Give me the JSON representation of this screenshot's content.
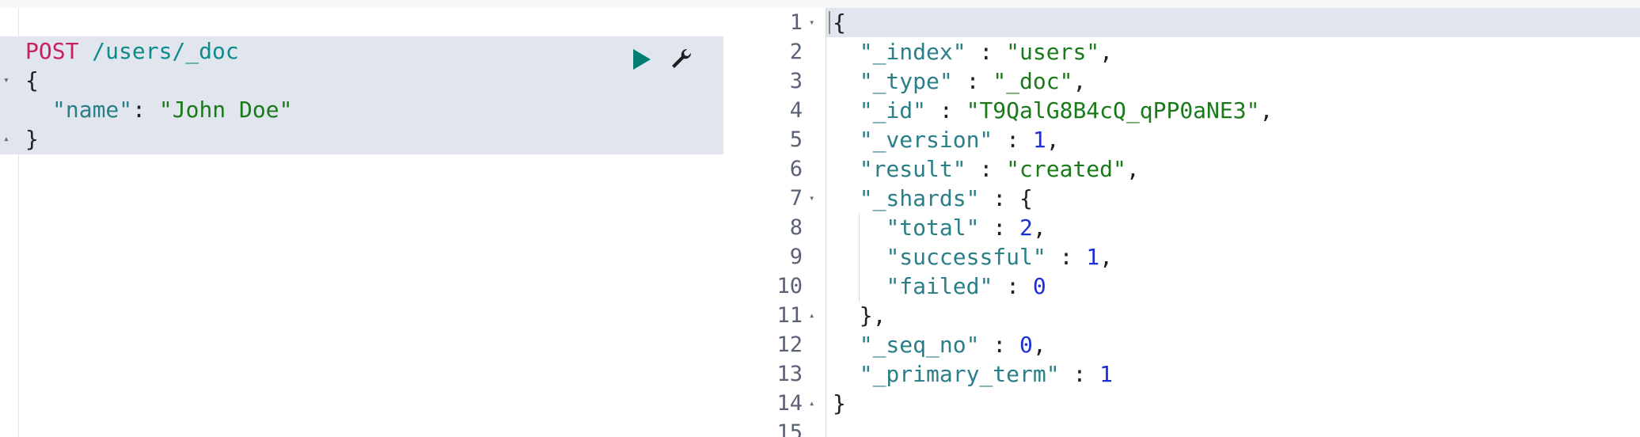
{
  "request": {
    "method": "POST",
    "path": "/users/_doc",
    "body": {
      "open_brace": "{",
      "key": "\"name\"",
      "colon": ": ",
      "value": "\"John Doe\"",
      "close_brace": "}"
    },
    "icons": {
      "run": "play-icon",
      "settings": "wrench-icon"
    }
  },
  "response": {
    "line_numbers": [
      "1",
      "2",
      "3",
      "4",
      "5",
      "6",
      "7",
      "8",
      "9",
      "10",
      "11",
      "12",
      "13",
      "14",
      "15"
    ],
    "lines": {
      "l1": "{",
      "l2_key": "\"_index\"",
      "l2_sep": " : ",
      "l2_val": "\"users\"",
      "l2_end": ",",
      "l3_key": "\"_type\"",
      "l3_sep": " : ",
      "l3_val": "\"_doc\"",
      "l3_end": ",",
      "l4_key": "\"_id\"",
      "l4_sep": " : ",
      "l4_val": "\"T9QalG8B4cQ_qPP0aNE3\"",
      "l4_end": ",",
      "l5_key": "\"_version\"",
      "l5_sep": " : ",
      "l5_val": "1",
      "l5_end": ",",
      "l6_key": "\"result\"",
      "l6_sep": " : ",
      "l6_val": "\"created\"",
      "l6_end": ",",
      "l7_key": "\"_shards\"",
      "l7_sep": " : ",
      "l7_val": "{",
      "l8_key": "\"total\"",
      "l8_sep": " : ",
      "l8_val": "2",
      "l8_end": ",",
      "l9_key": "\"successful\"",
      "l9_sep": " : ",
      "l9_val": "1",
      "l9_end": ",",
      "l10_key": "\"failed\"",
      "l10_sep": " : ",
      "l10_val": "0",
      "l11": "},",
      "l12_key": "\"_seq_no\"",
      "l12_sep": " : ",
      "l12_val": "0",
      "l12_end": ",",
      "l13_key": "\"_primary_term\"",
      "l13_sep": " : ",
      "l13_val": "1",
      "l14": "}"
    }
  },
  "colors": {
    "method": "#c7215d",
    "path": "#0c8b8b",
    "key": "#2a7e87",
    "string": "#1a7a1a",
    "number": "#1c2fd6",
    "run_button": "#017d73",
    "highlight": "#e1e6ee"
  }
}
